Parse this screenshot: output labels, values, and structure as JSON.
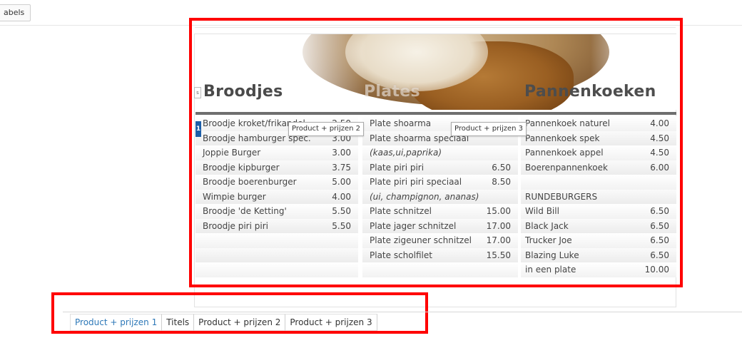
{
  "top_button": {
    "label": "abels"
  },
  "small_handle": {
    "label": "s"
  },
  "marker": {
    "label": "1"
  },
  "headings": {
    "col1": "Broodjes",
    "col2": "Plates",
    "col3": "Pannenkoeken"
  },
  "tags": {
    "tag2": "Product + prijzen 2",
    "tag3": "Product + prijzen 3"
  },
  "columns": {
    "col1": [
      {
        "name": "Broodje kroket/frikandel",
        "price": "2.50"
      },
      {
        "name": "Broodje hamburger spec.",
        "price": "3.00"
      },
      {
        "name": "Joppie Burger",
        "price": "3.00"
      },
      {
        "name": "Broodje kipburger",
        "price": "3.75"
      },
      {
        "name": "Broodje boerenburger",
        "price": "5.00"
      },
      {
        "name": "Wimpie burger",
        "price": "4.00"
      },
      {
        "name": "Broodje 'de Ketting'",
        "price": "5.50"
      },
      {
        "name": "Broodje piri piri",
        "price": "5.50"
      },
      {
        "name": "",
        "price": ""
      },
      {
        "name": "",
        "price": ""
      },
      {
        "name": "",
        "price": ""
      }
    ],
    "col2": [
      {
        "name": "Plate shoarma",
        "price": ""
      },
      {
        "name": "Plate shoarma speciaal",
        "price": ""
      },
      {
        "name": "(kaas,ui,paprika)",
        "price": "",
        "italic": true
      },
      {
        "name": "Plate piri piri",
        "price": "6.50"
      },
      {
        "name": "Plate piri piri speciaal",
        "price": "8.50"
      },
      {
        "name": "(ui, champignon, ananas)",
        "price": "",
        "italic": true
      },
      {
        "name": "Plate schnitzel",
        "price": "15.00"
      },
      {
        "name": "Plate jager schnitzel",
        "price": "17.00"
      },
      {
        "name": "Plate zigeuner schnitzel",
        "price": "17.00"
      },
      {
        "name": "Plate scholfilet",
        "price": "15.50"
      },
      {
        "name": "",
        "price": ""
      }
    ],
    "col3": [
      {
        "name": "Pannenkoek naturel",
        "price": "4.00"
      },
      {
        "name": "Pannenkoek spek",
        "price": "4.50"
      },
      {
        "name": "Pannenkoek appel",
        "price": "4.50"
      },
      {
        "name": "Boerenpannenkoek",
        "price": "6.00"
      },
      {
        "name": "",
        "price": ""
      },
      {
        "name": "RUNDEBURGERS",
        "price": ""
      },
      {
        "name": "Wild Bill",
        "price": "6.50"
      },
      {
        "name": "Black Jack",
        "price": "6.50"
      },
      {
        "name": "Trucker Joe",
        "price": "6.50"
      },
      {
        "name": "Blazing Luke",
        "price": "6.50"
      },
      {
        "name": "in een plate",
        "price": "10.00"
      }
    ]
  },
  "tabs": [
    {
      "label": "Product + prijzen 1",
      "active": true
    },
    {
      "label": "Titels",
      "active": false
    },
    {
      "label": "Product + prijzen 2",
      "active": false
    },
    {
      "label": "Product + prijzen 3",
      "active": false
    }
  ],
  "colors": {
    "highlight": "#ff0000",
    "active_tab": "#2d78b8",
    "marker": "#1e5fa8",
    "separator": "#6e6e6e"
  }
}
